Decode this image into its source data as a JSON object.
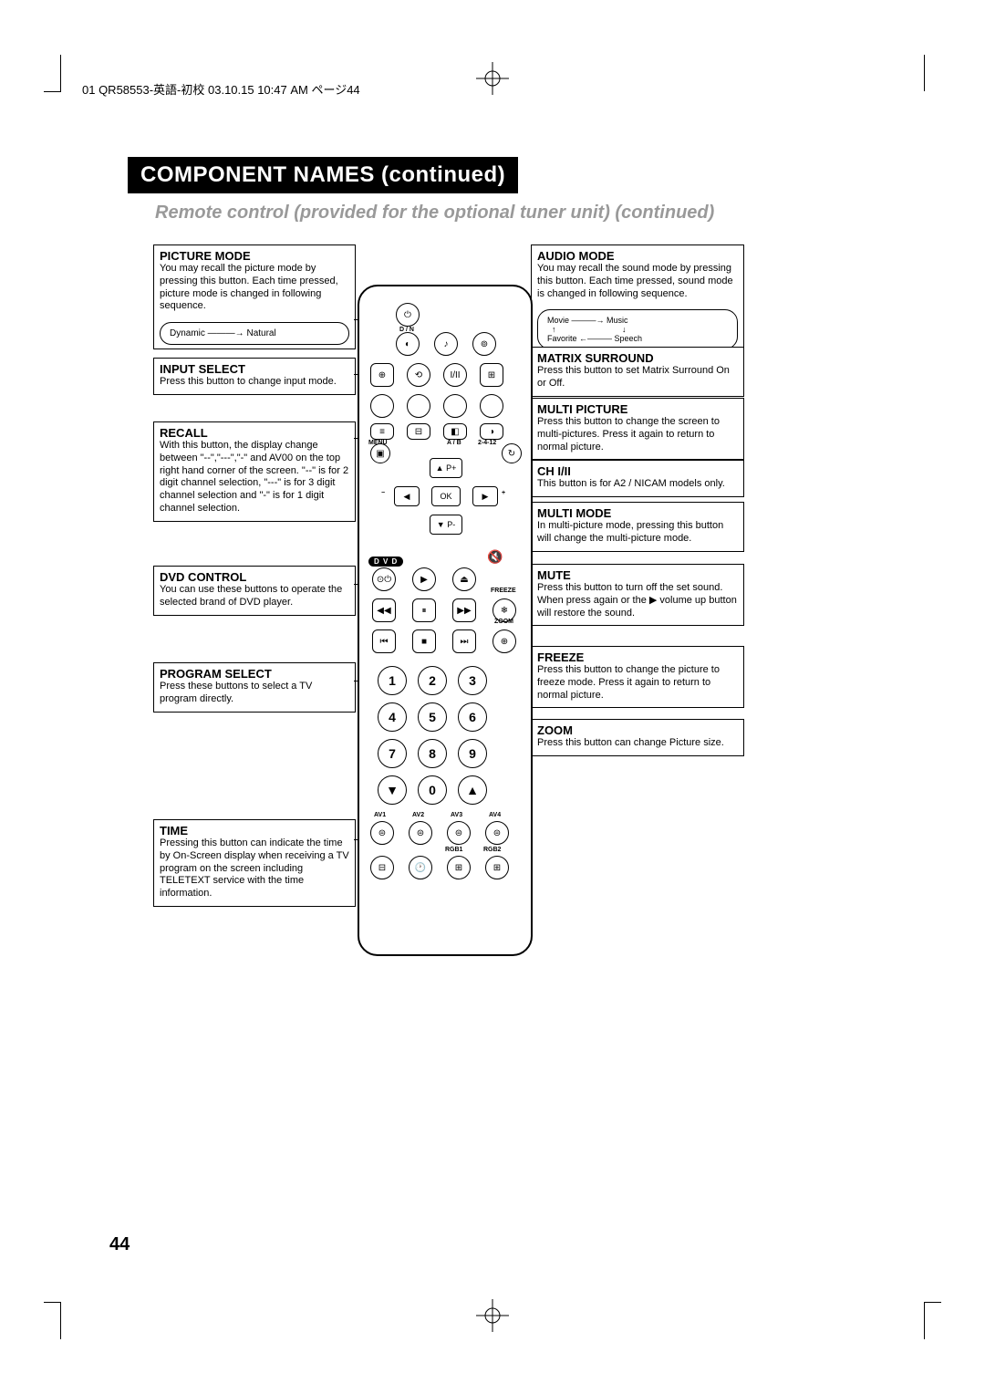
{
  "header_line": "01 QR58553-英語-初校  03.10.15  10:47 AM  ページ44",
  "section_title": "COMPONENT NAMES (continued)",
  "subtitle": "Remote control (provided for the optional tuner unit) (continued)",
  "page_number": "44",
  "left": {
    "picture_mode": {
      "title": "PICTURE MODE",
      "body": "You may recall the picture mode by pressing this button. Each time pressed, picture mode is changed in following sequence.",
      "seq": [
        "Dynamic",
        "Natural"
      ]
    },
    "input_select": {
      "title": "INPUT SELECT",
      "body": "Press this button to change input mode."
    },
    "recall": {
      "title": "RECALL",
      "body": "With this button, the display change between \"--\",\"---\",\"-\" and AV00 on the top right hand corner of the screen. \"--\" is for 2 digit channel selection, \"---\" is for 3 digit channel selection and \"-\" is for 1 digit channel selection."
    },
    "dvd_control": {
      "title": "DVD CONTROL",
      "body": "You can use these buttons to operate the selected brand of DVD player."
    },
    "program_select": {
      "title": "PROGRAM SELECT",
      "body": "Press these buttons to select a TV program directly."
    },
    "time": {
      "title": "TIME",
      "body": "Pressing this button can indicate the time by On-Screen display when receiving a TV program on the screen including TELETEXT service with the time information."
    }
  },
  "right": {
    "audio_mode": {
      "title": "AUDIO MODE",
      "body": "You may recall the sound mode by pressing this button. Each time pressed, sound mode is changed in following sequence.",
      "seq": [
        "Movie",
        "Music",
        "Speech",
        "Favorite"
      ]
    },
    "matrix_surround": {
      "title": "MATRIX SURROUND",
      "body": "Press this button to set Matrix Surround On or Off."
    },
    "multi_picture": {
      "title": "MULTI PICTURE",
      "body": "Press this button to change the screen to multi-pictures. Press it again to return to normal picture."
    },
    "ch": {
      "title": "CH I/II",
      "body": "This button is for A2 / NICAM models only."
    },
    "multi_mode": {
      "title": "MULTI MODE",
      "body": "In multi-picture mode, pressing this button will change the multi-picture mode."
    },
    "mute": {
      "title": "MUTE",
      "body": "Press this button to turn off the set sound. When press again or the ▶ volume up button will restore the sound."
    },
    "freeze": {
      "title": "FREEZE",
      "body": "Press this button to change the picture to freeze mode. Press it again to return to normal picture."
    },
    "zoom": {
      "title": "ZOOM",
      "body": "Press this button can change Picture size."
    }
  },
  "remote": {
    "dvd_label": "D V D",
    "labels": {
      "dn": "D / N",
      "menu": "MENU",
      "ab": "A / B",
      "d2412": "2-4-12",
      "freeze": "FREEZE",
      "zoom": "ZOOM",
      "av1": "AV1",
      "av2": "AV2",
      "av3": "AV3",
      "av4": "AV4",
      "rgb1": "RGB1",
      "rgb2": "RGB2"
    },
    "nav": {
      "up": "▲ P+",
      "down": "▼ P-",
      "left": "◀",
      "right": "▶",
      "ok": "OK",
      "minus": "−",
      "plus": "+"
    },
    "digits": [
      "1",
      "2",
      "3",
      "4",
      "5",
      "6",
      "7",
      "8",
      "9",
      "0"
    ]
  }
}
